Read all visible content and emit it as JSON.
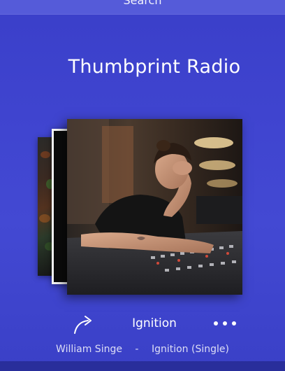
{
  "header": {
    "search_label": "Search"
  },
  "station": {
    "title": "Thumbprint Radio"
  },
  "now_playing": {
    "track": "Ignition",
    "artist": "William Singe",
    "separator": "-",
    "album": "Ignition (Single)"
  },
  "icons": {
    "share": "share-arrow-icon",
    "more": "more-dots-icon"
  },
  "colors": {
    "background": "#3f44cf",
    "text": "#ffffff"
  }
}
